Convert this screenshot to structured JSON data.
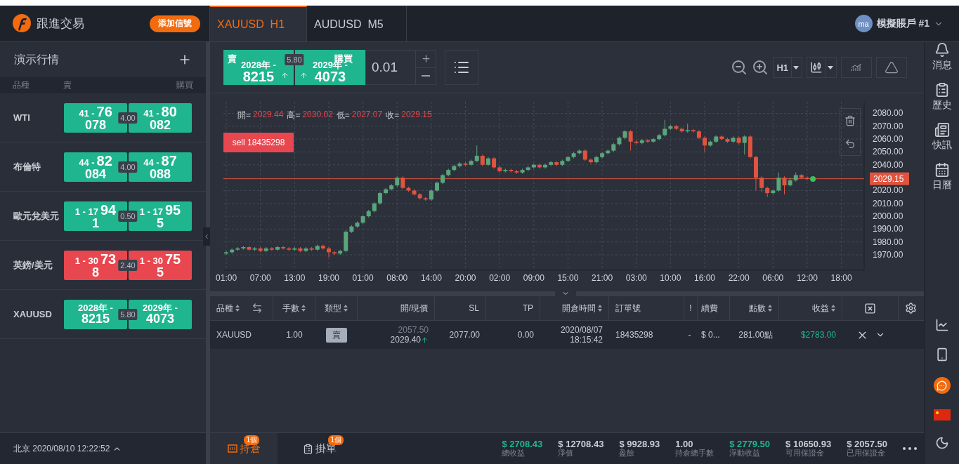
{
  "header": {
    "brand": "跟進交易",
    "add_signal_button": "添加信號",
    "tabs": [
      {
        "label": "XAUUSD  H1",
        "selected": true
      },
      {
        "label": "AUDUSD  M5",
        "selected": false
      }
    ],
    "account": {
      "avatar": "ma",
      "name": "模擬賬戶 #1"
    }
  },
  "watchlist": {
    "title": "演示行情",
    "columns": [
      "品種",
      "賣",
      "購買"
    ],
    "rows": [
      {
        "symbol": "WTI",
        "color": "#1fb58f",
        "bid": {
          "small": "41 -",
          "big": "76",
          "tail": "078"
        },
        "spread": "4.00",
        "ask": {
          "small": "41 -",
          "big": "80",
          "tail": "082"
        }
      },
      {
        "symbol": "布倫特",
        "color": "#1fb58f",
        "bid": {
          "small": "44 -",
          "big": "82",
          "tail": "084"
        },
        "spread": "4.00",
        "ask": {
          "small": "44 -",
          "big": "87",
          "tail": "088"
        }
      },
      {
        "symbol": "歐元兌美元",
        "color": "#1fb58f",
        "bid": {
          "small": "1 - 17",
          "big": "94",
          "tail": "1"
        },
        "spread": "0.50",
        "ask": {
          "small": "1 - 17",
          "big": "95",
          "tail": "5"
        }
      },
      {
        "symbol": "英鎊/美元",
        "color": "#e8474f",
        "bid": {
          "small": "1 - 30",
          "big": "73",
          "tail": "8"
        },
        "spread": "2.40",
        "ask": {
          "small": "1 - 30",
          "big": "75",
          "tail": "5"
        }
      },
      {
        "symbol": "XAUUSD",
        "color": "#1fb58f",
        "bid": {
          "small": "2028年 -",
          "tail": "8215"
        },
        "spread": "5.80",
        "ask": {
          "small": "2029年 -",
          "tail": "4073"
        }
      }
    ],
    "clock": "北京 2020/08/10 12:22:52"
  },
  "trade": {
    "sell": {
      "label": "賣",
      "small": "2028年 -",
      "tail": "8215"
    },
    "spread": "5.80",
    "buy": {
      "label": "購買",
      "small": "2029年 -",
      "tail": "4073"
    },
    "volume": "0.01",
    "timeframe": "H1"
  },
  "chart": {
    "legend": [
      {
        "label": "開=",
        "value": "2029.44"
      },
      {
        "label": "高=",
        "value": "2030.02"
      },
      {
        "label": "低=",
        "value": "2027.07"
      },
      {
        "label": "收=",
        "value": "2029.15"
      }
    ],
    "order_marker": "sell 18435298",
    "chart_data": {
      "type": "candlestick",
      "grid": true,
      "ylim": [
        1958,
        2089
      ],
      "yticks": [
        {
          "value": 1970,
          "label": "1970.00"
        },
        {
          "value": 1980,
          "label": "1980.00"
        },
        {
          "value": 1990,
          "label": "1990.00"
        },
        {
          "value": 2000,
          "label": "2000.00"
        },
        {
          "value": 2010,
          "label": "2010.00"
        },
        {
          "value": 2020,
          "label": "2020.00"
        },
        {
          "value": 2040,
          "label": "2040.00"
        },
        {
          "value": 2050,
          "label": "2050.00"
        },
        {
          "value": 2060,
          "label": "2060.00"
        },
        {
          "value": 2070,
          "label": "2070.00"
        },
        {
          "value": 2080,
          "label": "2080.00"
        }
      ],
      "ref_lines": [
        {
          "axis": "y",
          "value": 2029.15,
          "label": "2029.15",
          "color": "#e0533f"
        }
      ],
      "categories": [
        "01:00",
        null,
        null,
        null,
        null,
        null,
        "07:00",
        null,
        null,
        null,
        null,
        null,
        "13:00",
        null,
        null,
        null,
        null,
        null,
        "19:00",
        null,
        null,
        null,
        null,
        null,
        "01:00",
        null,
        null,
        null,
        null,
        null,
        "08:00",
        null,
        null,
        null,
        null,
        null,
        "14:00",
        null,
        null,
        null,
        null,
        null,
        "20:00",
        null,
        null,
        null,
        null,
        null,
        "02:00",
        null,
        null,
        null,
        null,
        null,
        "09:00",
        null,
        null,
        null,
        null,
        null,
        "15:00",
        null,
        null,
        null,
        null,
        null,
        "21:00",
        null,
        null,
        null,
        null,
        null,
        "03:00",
        null,
        null,
        null,
        null,
        null,
        "10:00",
        null,
        null,
        null,
        null,
        null,
        "16:00",
        null,
        null,
        null,
        null,
        null,
        "22:00",
        null,
        null,
        null,
        null,
        null,
        "06:00",
        null,
        null,
        null,
        null,
        null,
        "12:00",
        null,
        null,
        null,
        null,
        null,
        "18:00"
      ],
      "ohlc": [
        [
          1971,
          1973,
          1970,
          1972
        ],
        [
          1972,
          1975,
          1971,
          1974
        ],
        [
          1974,
          1976,
          1973,
          1975
        ],
        [
          1975,
          1977,
          1974,
          1976
        ],
        [
          1976,
          1977,
          1973,
          1974
        ],
        [
          1974,
          1976,
          1973,
          1975
        ],
        [
          1975,
          1976,
          1972,
          1973
        ],
        [
          1973,
          1976,
          1972,
          1975
        ],
        [
          1975,
          1976,
          1973,
          1974
        ],
        [
          1974,
          1977,
          1973,
          1976
        ],
        [
          1976,
          1977,
          1974,
          1975
        ],
        [
          1975,
          1976,
          1973,
          1974
        ],
        [
          1974,
          1976,
          1973,
          1975
        ],
        [
          1975,
          1976,
          1972,
          1973
        ],
        [
          1973,
          1976,
          1972,
          1975
        ],
        [
          1975,
          1976,
          1973,
          1974
        ],
        [
          1974,
          1978,
          1973,
          1977
        ],
        [
          1977,
          1978,
          1974,
          1975
        ],
        [
          1975,
          1976,
          1968,
          1972
        ],
        [
          1972,
          1973,
          1970,
          1971
        ],
        [
          1971,
          1974,
          1970,
          1973
        ],
        [
          1973,
          1989,
          1972,
          1988
        ],
        [
          1988,
          1993,
          1987,
          1992
        ],
        [
          1992,
          1996,
          1991,
          1995
        ],
        [
          1995,
          2001,
          1994,
          2000
        ],
        [
          2000,
          2005,
          1999,
          2004
        ],
        [
          2004,
          2011,
          2003,
          2010
        ],
        [
          2010,
          2019,
          2009,
          2018
        ],
        [
          2018,
          2022,
          2017,
          2021
        ],
        [
          2021,
          2025,
          2020,
          2024
        ],
        [
          2024,
          2031,
          2023,
          2030
        ],
        [
          2030,
          2031,
          2021,
          2022
        ],
        [
          2022,
          2023,
          2019,
          2020
        ],
        [
          2020,
          2021,
          2016,
          2017
        ],
        [
          2017,
          2018,
          2013,
          2014
        ],
        [
          2014,
          2015,
          2012,
          2013
        ],
        [
          2013,
          2021,
          2012,
          2020
        ],
        [
          2020,
          2027,
          2019,
          2026
        ],
        [
          2026,
          2033,
          2025,
          2032
        ],
        [
          2032,
          2037,
          2031,
          2036
        ],
        [
          2036,
          2040,
          2035,
          2039
        ],
        [
          2039,
          2042,
          2038,
          2041
        ],
        [
          2041,
          2042,
          2039,
          2040
        ],
        [
          2040,
          2044,
          2039,
          2043
        ],
        [
          2043,
          2055,
          2042,
          2047
        ],
        [
          2047,
          2048,
          2039,
          2040
        ],
        [
          2040,
          2046,
          2039,
          2045
        ],
        [
          2045,
          2046,
          2037,
          2038
        ],
        [
          2038,
          2039,
          2034,
          2035
        ],
        [
          2035,
          2037,
          2034,
          2036
        ],
        [
          2036,
          2037,
          2034,
          2035
        ],
        [
          2035,
          2036,
          2033,
          2034
        ],
        [
          2034,
          2037,
          2033,
          2036
        ],
        [
          2036,
          2039,
          2035,
          2038
        ],
        [
          2038,
          2041,
          2037,
          2040
        ],
        [
          2040,
          2041,
          2037,
          2038
        ],
        [
          2038,
          2041,
          2037,
          2040
        ],
        [
          2040,
          2043,
          2039,
          2042
        ],
        [
          2042,
          2043,
          2039,
          2040
        ],
        [
          2040,
          2044,
          2039,
          2043
        ],
        [
          2043,
          2047,
          2042,
          2046
        ],
        [
          2046,
          2050,
          2045,
          2049
        ],
        [
          2049,
          2052,
          2048,
          2051
        ],
        [
          2051,
          2052,
          2043,
          2044
        ],
        [
          2044,
          2045,
          2041,
          2042
        ],
        [
          2042,
          2047,
          2041,
          2046
        ],
        [
          2046,
          2050,
          2045,
          2049
        ],
        [
          2049,
          2052,
          2048,
          2051
        ],
        [
          2051,
          2057,
          2050,
          2056
        ],
        [
          2056,
          2062,
          2055,
          2061
        ],
        [
          2061,
          2067,
          2060,
          2066
        ],
        [
          2066,
          2067,
          2051,
          2058
        ],
        [
          2058,
          2059,
          2056,
          2057
        ],
        [
          2057,
          2060,
          2056,
          2059
        ],
        [
          2059,
          2060,
          2057,
          2058
        ],
        [
          2058,
          2061,
          2057,
          2060
        ],
        [
          2060,
          2064,
          2059,
          2063
        ],
        [
          2063,
          2075,
          2062,
          2068
        ],
        [
          2068,
          2071,
          2067,
          2070
        ],
        [
          2070,
          2071,
          2067,
          2068
        ],
        [
          2068,
          2069,
          2065,
          2066
        ],
        [
          2066,
          2072,
          2065,
          2067
        ],
        [
          2067,
          2068,
          2065,
          2066
        ],
        [
          2066,
          2067,
          2060,
          2061
        ],
        [
          2061,
          2062,
          2050,
          2055
        ],
        [
          2055,
          2059,
          2054,
          2058
        ],
        [
          2058,
          2063,
          2057,
          2062
        ],
        [
          2062,
          2063,
          2059,
          2060
        ],
        [
          2060,
          2061,
          2057,
          2058
        ],
        [
          2058,
          2062,
          2057,
          2061
        ],
        [
          2061,
          2062,
          2056,
          2057
        ],
        [
          2057,
          2063,
          2048,
          2062
        ],
        [
          2062,
          2063,
          2045,
          2046
        ],
        [
          2046,
          2047,
          2020,
          2030
        ],
        [
          2030,
          2031,
          2019,
          2022
        ],
        [
          2022,
          2023,
          2015,
          2018
        ],
        [
          2018,
          2021,
          2017,
          2020
        ],
        [
          2020,
          2034,
          2019,
          2030
        ],
        [
          2030,
          2031,
          2017,
          2024
        ],
        [
          2024,
          2030,
          2023,
          2028
        ],
        [
          2028,
          2034,
          2027,
          2032
        ],
        [
          2032,
          2033,
          2029,
          2030
        ],
        [
          2030,
          2031,
          2028,
          2029
        ],
        null,
        null,
        null,
        null,
        null,
        null
      ]
    }
  },
  "positions": {
    "columns": [
      {
        "label": "品種",
        "sortable": true
      },
      {
        "label": "手數",
        "sortable": true
      },
      {
        "label": "類型",
        "sortable": true
      },
      {
        "label": "開/現價",
        "sortable": false
      },
      {
        "label": "SL",
        "sortable": false
      },
      {
        "label": "TP",
        "sortable": false
      },
      {
        "label": "開倉時間",
        "sortable": true
      },
      {
        "label": "訂單號",
        "sortable": false
      },
      {
        "label": "!",
        "sortable": false
      },
      {
        "label": "續費",
        "sortable": false
      },
      {
        "label": "點數",
        "sortable": true
      },
      {
        "label": "收益",
        "sortable": true
      }
    ],
    "rows": [
      {
        "symbol": "XAUUSD",
        "lots": "1.00",
        "type": "賣",
        "open_price": "2057.50",
        "current_price": "2029.40",
        "sl": "2077.00",
        "tp": "0.00",
        "open_date": "2020/08/07",
        "open_time": "18:15:42",
        "order": "18435298",
        "column_9": "-",
        "fee": "$ 0...",
        "points": "281.00點",
        "profit": "$2783.00"
      }
    ]
  },
  "bottom": {
    "tabs": [
      {
        "label": "持倉",
        "count": "1個",
        "selected": true
      },
      {
        "label": "掛單",
        "count": "1個",
        "selected": false
      }
    ],
    "stats": [
      {
        "value": "$ 2708.43",
        "label": "總收益",
        "color": "#1fb58f"
      },
      {
        "value": "$ 12708.43",
        "label": "淨值",
        "color": "#c9ccd3"
      },
      {
        "value": "$ 9928.93",
        "label": "盈餘",
        "color": "#c9ccd3"
      },
      {
        "value": "1.00",
        "label": "持倉總手數",
        "color": "#c9ccd3"
      },
      {
        "value": "$ 2779.50",
        "label": "浮動收益",
        "color": "#1fb58f"
      },
      {
        "value": "$ 10650.93",
        "label": "可用保證金",
        "color": "#c9ccd3"
      },
      {
        "value": "$ 2057.50",
        "label": "已用保證金",
        "color": "#c9ccd3"
      }
    ]
  },
  "sidebar": {
    "items": [
      "消息",
      "歷史",
      "快訊",
      "日曆"
    ]
  }
}
